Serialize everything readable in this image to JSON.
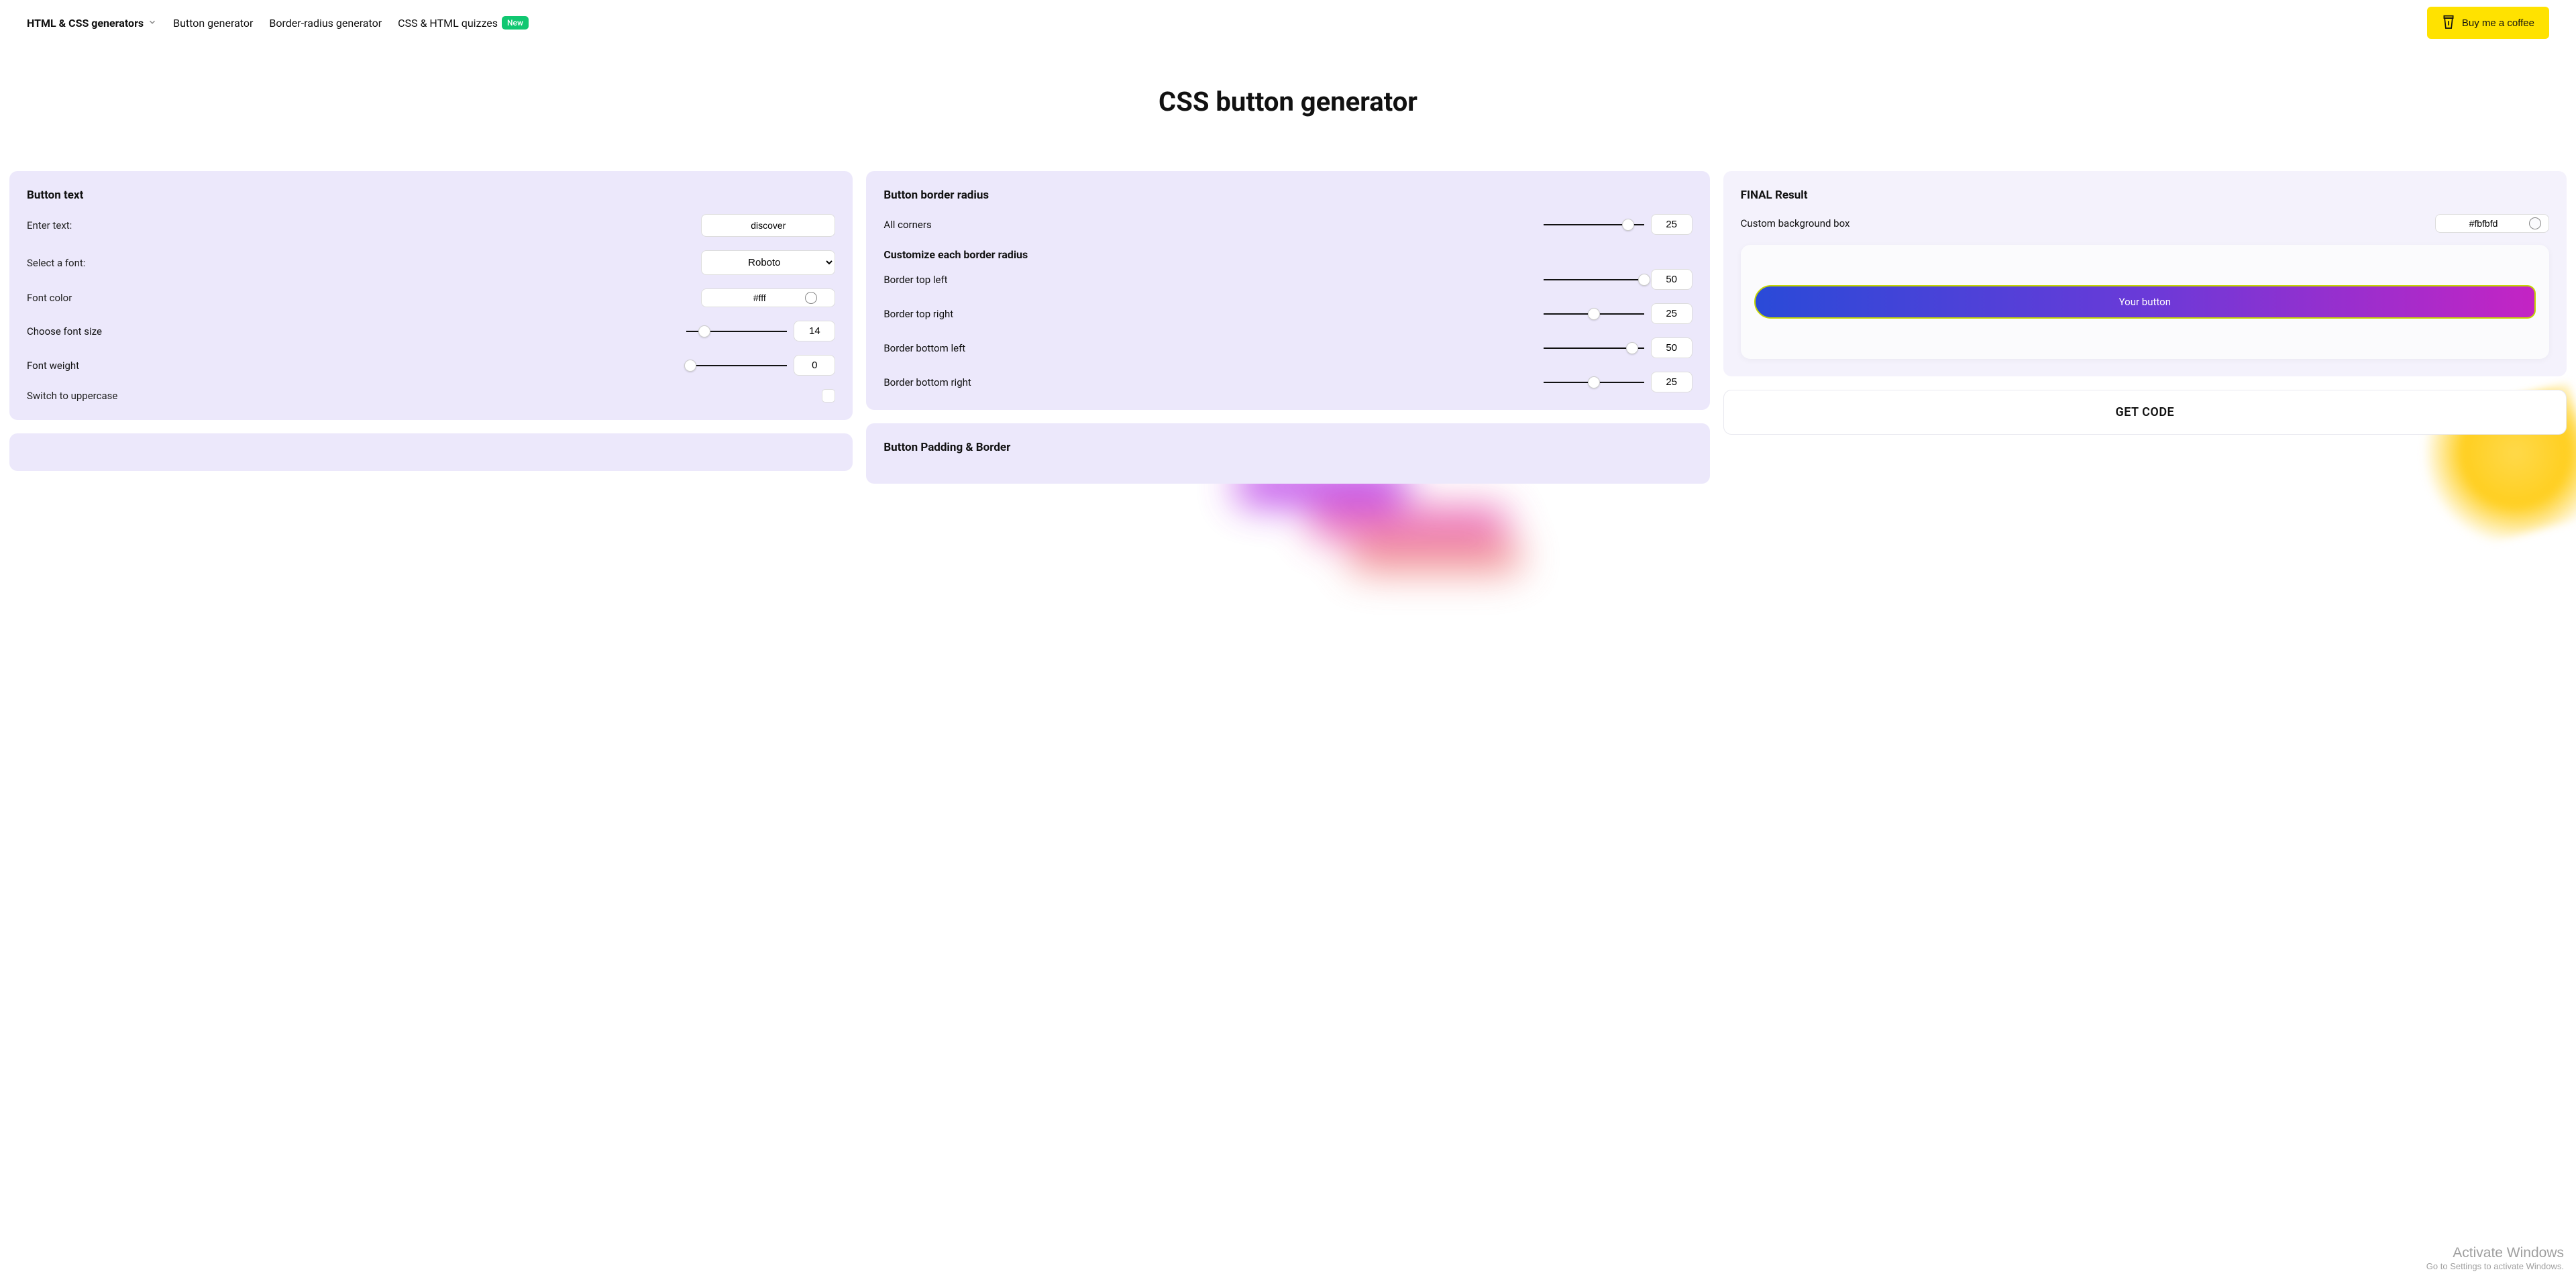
{
  "nav": {
    "main": "HTML & CSS generators",
    "items": [
      "Button generator",
      "Border-radius generator",
      "CSS & HTML quizzes"
    ],
    "badge": "New",
    "coffee": "Buy me a coffee"
  },
  "title": "CSS button generator",
  "text_panel": {
    "heading": "Button text",
    "enter_label": "Enter text:",
    "enter_value": "discover",
    "font_label": "Select a font:",
    "font_value": "Roboto",
    "color_label": "Font color",
    "color_value": "#fff",
    "size_label": "Choose font size",
    "size_value": "14",
    "weight_label": "Font weight",
    "weight_value": "0",
    "upper_label": "Switch to uppercase"
  },
  "radius_panel": {
    "heading": "Button border radius",
    "all_label": "All corners",
    "all_value": "25",
    "sub_heading": "Customize each border radius",
    "tl_label": "Border top left",
    "tl_value": "50",
    "tr_label": "Border top right",
    "tr_value": "25",
    "bl_label": "Border bottom left",
    "bl_value": "50",
    "br_label": "Border bottom right",
    "br_value": "25"
  },
  "padding_panel": {
    "heading": "Button Padding & Border"
  },
  "result_panel": {
    "heading": "FINAL Result",
    "bg_label": "Custom background box",
    "bg_value": "#fbfbfd",
    "button_text": "Your button"
  },
  "get_code": "GET CODE",
  "watermark": {
    "line1": "Activate Windows",
    "line2": "Go to Settings to activate Windows."
  },
  "slider_positions": {
    "all": 84,
    "tl": 100,
    "tr": 50,
    "bl": 88,
    "br": 50,
    "size": 18,
    "weight": 4
  }
}
